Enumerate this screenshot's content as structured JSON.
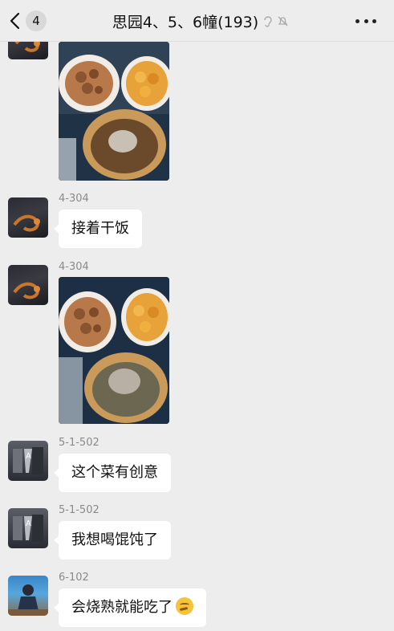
{
  "nav": {
    "unread_count": "4",
    "title": "思园4、5、6幢(193)"
  },
  "messages": [
    {
      "type": "image",
      "sender": "",
      "description": "food photo (top, partially visible)"
    },
    {
      "type": "text",
      "sender": "4-304",
      "text": "接着干饭"
    },
    {
      "type": "image",
      "sender": "4-304"
    },
    {
      "type": "text",
      "sender": "5-1-502",
      "text": "这个菜有创意"
    },
    {
      "type": "text",
      "sender": "5-1-502",
      "text": "我想喝馄饨了"
    },
    {
      "type": "text",
      "sender": "6-102",
      "text": "会烧熟就能吃了",
      "emoji": "thinking-face"
    }
  ],
  "colors": {
    "background": "#ededed",
    "bubble": "#ffffff",
    "sender_text": "#8a8a8a"
  }
}
